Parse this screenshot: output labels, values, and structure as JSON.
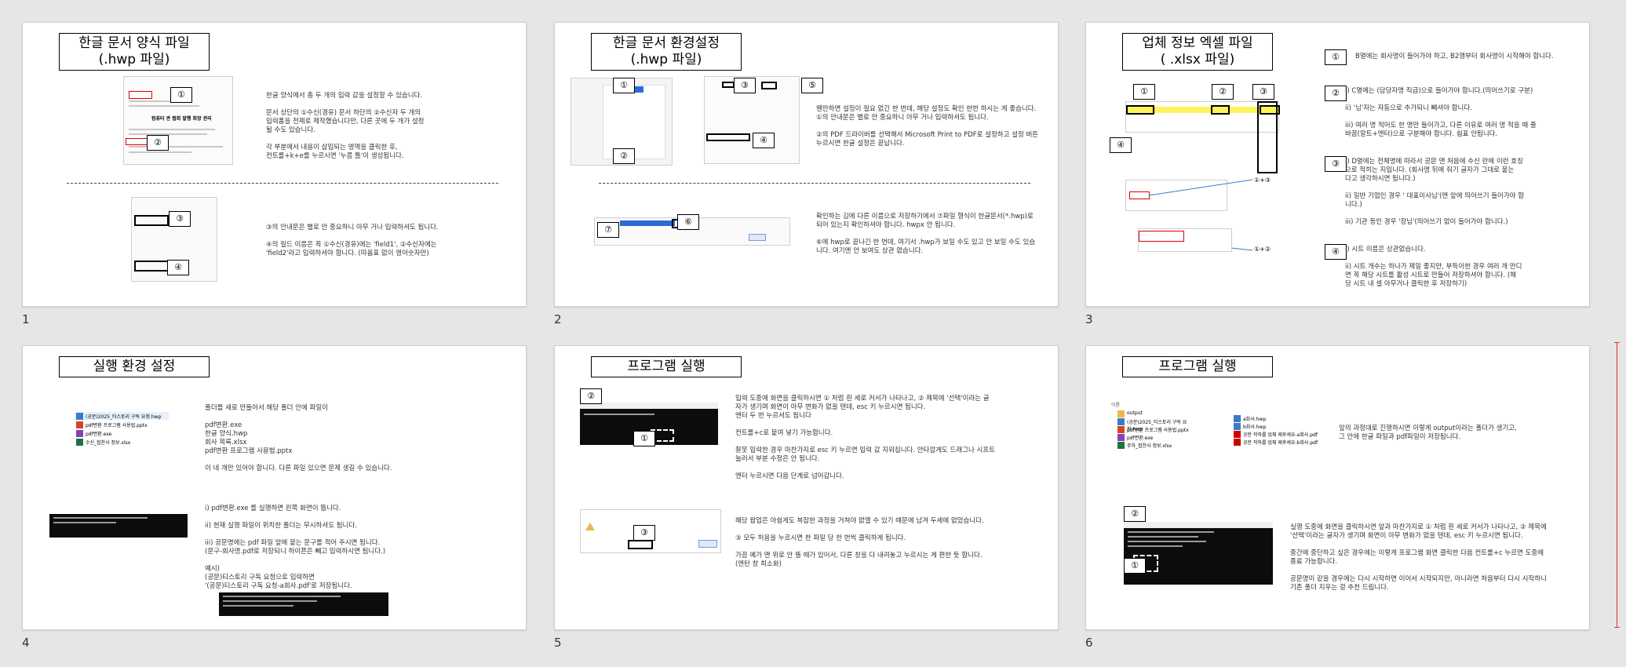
{
  "slides": [
    {
      "number": "1",
      "title": "한글 문서 양식 파일\n(.hwp 파일)",
      "text_top": "한글 양식에서 총 두 개의 입력 값을 설정할 수 있습니다.\n\n문서 상단의 ①수신(경유) 문서 하단의 ②수신자 두 개의\n입력폼을 전제로 제작했습니다만, 다른 곳에 두 개가 설정\n될 수도 있습니다.\n\n각 부분에서 내용이 삽입되는 영역을 클릭한 후,\n컨트롤+k+e를 누르시면 '누름 틀'이 생성됩니다.",
      "text_bottom": "③의 안내문은 별로 안 중요하니 아무 거나 입력하셔도 됩니다.\n\n④의 필드 이름은 꼭 ①수신(경유)에는 'field1', ②수신자에는\n'field2'라고 입력하셔야 합니다. (따옴표 없이 영어숫자만)",
      "doc_heading": "컴퓨터 관 협회 발행 회장 권리",
      "markers": [
        "①",
        "②",
        "③",
        "④"
      ]
    },
    {
      "number": "2",
      "title": "한글 문서 환경설정\n(.hwp 파일)",
      "text_top": "웬만하면 설정이 필요 없긴 한 번데, 해당 설정도 확인 한번 하시는 게 좋습니다.\n①의 안내문은 별로 안 중요하니 아무 거나 입력하셔도 됩니다.\n\n②의 PDF 드라이버를 선택해서 Microsoft Print to PDF로 설정하고 설정 버튼\n누르시면 한글 설정은 끝납니다.",
      "text_bottom": "확인하는 김에 다른 이름으로 저장하기에서 ⑦파일 형식이 한글문서(*.hwp)로\n되어 있는지 확인하셔야 합니다. hwpx 안 됩니다.\n\n⑥에 hwp로 끝나긴 한 번데, 여기서 .hwp가 보일 수도 있고 안 보일 수도 있습\n니다. 여기엔 안 보여도 상관 없습니다.",
      "markers": [
        "①",
        "②",
        "③",
        "④",
        "⑤",
        "⑥",
        "⑦"
      ]
    },
    {
      "number": "3",
      "title": "업체 정보 엑셀 파일\n( .xlsx 파일)",
      "items": [
        {
          "marker": "①",
          "text": "B열에는 회사명이 들어가야 하고, B2행부터 회사명이 시작해야 합니다."
        },
        {
          "marker": "②",
          "text": "i)    C열에는 (담당자명 직급)으로 들어가야 합니다.(띄어쓰기로 구분)\n\nii)    '님'자는 자동으로 추가되니 빼셔야 합니다.\n\niii)   여러 명 적어도 한 명만 들어가고, 다른 이유로 여러 명 적을 때 줄\n       바꿈(알트+엔터)으로 구분해야 합니다. 쉼표 안됩니다."
        },
        {
          "marker": "③",
          "text": "i)    D열에는 전체명에 따라서 공문 맨 처음에 수신 란에 이런 호칭\n       으로 적히는 지입니다. (회사명 뒤에 줘기 글자가 그대로 붙는\n       다고 생각하시면 됩니다.)\n\nii)    일반 기업인 경우 ' 대표이사님'(맨 앞에 띄어쓰기 들어가야 합\n       니다.)\n\niii)   기관 등인 경우 '장님'(띄어쓰기 없이 들어가야 합니다.)"
        },
        {
          "marker": "④",
          "text": "i)    시트 이름은 상관없습니다.\n\nii)    시트 개수는 하나가 제일 좋지만, 부득이한 경우 여러 개 만디\n       면 꼭 해당 시트를 활성 시트로 만들어 저장하셔야 합니다. (해\n       당 시트 내 셀 아무거나 클릭한 후 저장하기)"
        }
      ],
      "arrow_labels": [
        "①+③",
        "①+②"
      ],
      "markers": [
        "①",
        "②",
        "③",
        "④"
      ]
    },
    {
      "number": "4",
      "title": "실행 환경 설정",
      "files": [
        "(공문)2025_티스토리 구독 요청.hwp",
        "pdf변환 프로그램 사용법.pptx",
        "pdf변환.exe",
        "수신_협찬사 정보.xlsx"
      ],
      "text_top": "폴더를 새로 만들어서 해당 폴더 안에 파일이\n\npdf변환.exe\n한글 양식.hwp\n회사 목록.xlsx\npdf변환 프로그램 사용법.pptx\n\n이 네 개만 있어야 합니다. 다른 파일 있으면 문제 생길 수 있습니다.",
      "text_bottom": "i)    pdf변환.exe 를 실행하면 왼쪽 화면이 뜹니다.\n\nii)    현재 실행 파일이 위치한 폴더는 무시하셔도 됩니다.\n\niii)   공문명에는 pdf 파일 앞에 붙는 문구를 적어 주시면 됩니다.\n       (문구-회사명.pdf로 저장되니 하이픈은 빼고 입력하시면 됩니다.)\n\n예시)\n(공문)티스토리 구독 요청으로 입력하면\n'(공문)티스토리 구독 요청-a회사.pdf'로 저장됩니다."
    },
    {
      "number": "5",
      "title": "프로그램 실행",
      "text_top": "입력 도중에 화면을 클릭하시면 ① 처럼 흰 세로 커서가 나타나고, ② 제목에 '선택'이라는 글\n자가 생기며 화면이 아무 변화가 없을 텐데, esc 키 누르시면 됩니다.\n엔터 두 번 누르셔도 됩니다\n\n컨트롤+c로 붙여 넣기 가능합니다.\n\n잘못 입력한 경우 마찬가지로 esc 키 누르면 입력 값 지워집니다. 안타깝게도 드래그나 시프트\n눌러서 부분 수정은 안 됩니다.\n\n엔터 누르시면 다음 단계로 넘어갑니다.",
      "text_bottom": "해당 팝업은 아쉽게도 복잡한 과정을 거쳐야 없앨 수 있기 때문에 남겨 두세에 없었습니다.\n\n③ 모두 허용을 누르시면 한 파일 당 한 번씩 클릭하게 됩니다.\n\n가끔 예가 맨 위로 안 뜰 때가 있어서, 다른 창을 다 내려놓고 누르시는 게 편한 듯 합니다.\n(엔탄 창 최소화)",
      "markers": [
        "①",
        "②",
        "③"
      ]
    },
    {
      "number": "6",
      "title": "프로그램 실행",
      "left_files": [
        "output",
        "(공문)2025_티스토리 구독 요청.hwp",
        "pdf변환 프로그램 사용법.pptx",
        "pdf변환.exe",
        "주하_협찬사 정보.xlsx"
      ],
      "right_files": [
        "a회사.hwp",
        "b회사.hwp",
        "공문 작하를 업체 제후세요-a회사.pdf",
        "공문 작하를 업체 제후세요-b회사.pdf"
      ],
      "file_header": "이름",
      "text_top": "앞의 과정대로 진행하시면 이렇게 output이라는 폴더가 생기고,\n그 안에 한글 파일과 pdf파일이 저장됩니다.",
      "text_bottom": "실행 도중에 화면을 클릭하시면 앞과 마찬가지로 ① 처럼 흰 세로 커서가 나타나고, ② 제목에\n'선택'이라는 글자가 생기며 화면이 아무 변화가 없을 텐데, esc 키 누르시면 됩니다.\n\n중간에 중단하고 싶은 경우에는 이렇게 프로그램 화면 클릭한 다음 컨트롤+c 누르면 도중에\n종료 가능합니다.\n\n공문명이 같을 경우에는 다시 시작하면 이어서 시작되지만, 아니라면 처음부터 다시 시작하니\n기존 폴더 지우는 걸 추천 드립니다.",
      "markers": [
        "①",
        "②"
      ]
    }
  ],
  "colors": {
    "accent_red": "#d00000",
    "arrow_blue": "#3a7bc8",
    "folder_yellow": "#e8b84a",
    "excel_highlight": "#fff35c"
  }
}
